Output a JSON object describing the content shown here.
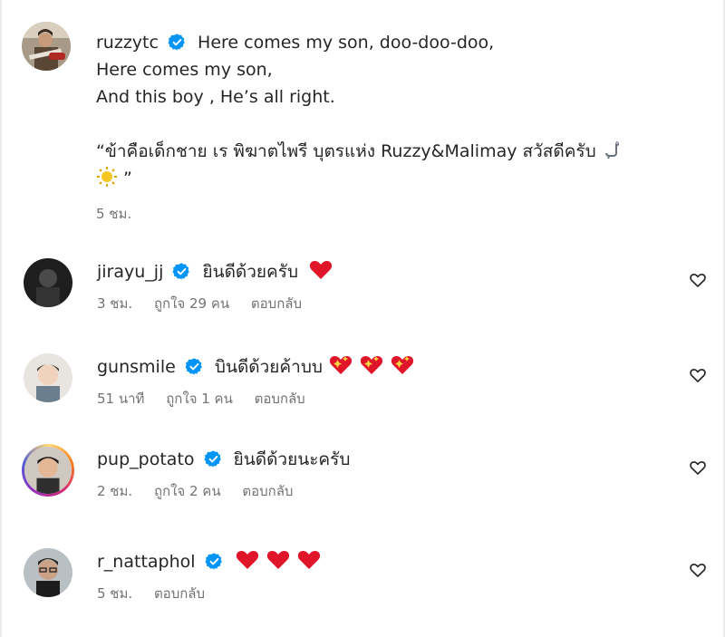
{
  "caption": {
    "username": "ruzzytc",
    "lines": [
      "Here comes my son, doo-doo-doo,",
      "Here comes my son,",
      "And this boy , He’s all right."
    ],
    "quote_line1": "“ข้าคือเด็กชาย เร พิฆาตไพรี บุตรแห่ง Ruzzy&Malimay สวัสดีครับ",
    "quote_line2": "”",
    "time": "5 ชม."
  },
  "comments": [
    {
      "username": "jirayu_jj",
      "text": "ยินดีด้วยครับ",
      "emojis": [
        "red-heart"
      ],
      "time": "3 ชม.",
      "likes": "ถูกใจ 29 คน",
      "reply": "ตอบกลับ"
    },
    {
      "username": "gunsmile",
      "text": "บินดีด้วยค้าบบ",
      "emojis": [
        "sparkling-heart",
        "sparkling-heart",
        "sparkling-heart"
      ],
      "time": "51 นาที",
      "likes": "ถูกใจ 1 คน",
      "reply": "ตอบกลับ"
    },
    {
      "username": "pup_potato",
      "text": "ยินดีด้วยนะครับ",
      "emojis": [],
      "time": "2 ชม.",
      "likes": "ถูกใจ 2 คน",
      "reply": "ตอบกลับ"
    },
    {
      "username": "r_nattaphol",
      "text": "",
      "emojis": [
        "red-heart",
        "red-heart",
        "red-heart"
      ],
      "time": "5 ชม.",
      "likes": "",
      "reply": "ตอบกลับ"
    }
  ],
  "colors": {
    "text": "#262626",
    "meta": "#737373",
    "verified": "#0095f6",
    "heart_red": "#e0152a"
  }
}
